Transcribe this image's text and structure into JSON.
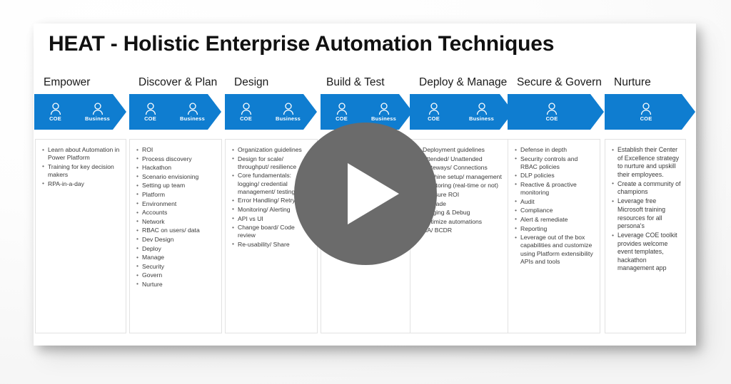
{
  "slide": {
    "title": "HEAT - Holistic Enterprise Automation Techniques",
    "accent_color": "#0F7DD0",
    "card_background": "#FFFFFF",
    "overlay_color": "#6B6B6B"
  },
  "player": {
    "play_button_label": "Play"
  },
  "phases": [
    {
      "name": "Empower",
      "personas": [
        {
          "label": "COE",
          "icon": "person-icon"
        },
        {
          "label": "Business",
          "icon": "person-icon"
        }
      ],
      "items": [
        "Learn about Automation in Power Platform",
        "Training for key decision makers",
        "RPA-in-a-day"
      ]
    },
    {
      "name": "Discover & Plan",
      "personas": [
        {
          "label": "COE",
          "icon": "person-icon"
        },
        {
          "label": "Business",
          "icon": "person-icon"
        }
      ],
      "items": [
        "ROI",
        "Process discovery",
        "Hackathon",
        "Scenario envisioning",
        "Setting up team",
        "Platform",
        "Environment",
        "Accounts",
        "Network",
        "RBAC on users/ data",
        "Dev Design",
        "Deploy",
        "Manage",
        "Security",
        "Govern",
        "Nurture"
      ]
    },
    {
      "name": "Design",
      "personas": [
        {
          "label": "COE",
          "icon": "person-icon"
        },
        {
          "label": "Business",
          "icon": "person-icon"
        }
      ],
      "items": [
        "Organization guidelines",
        "Design for scale/ throughput/ resilience",
        "Core fundamentals: logging/ credential management/ testing",
        "Error Handling/ Retry",
        "Monitoring/ Alerting",
        "API vs UI",
        "Change board/ Code review",
        "Re-usability/ Share"
      ]
    },
    {
      "name": "Build & Test",
      "personas": [
        {
          "label": "COE",
          "icon": "person-icon"
        },
        {
          "label": "Business",
          "icon": "person-icon"
        }
      ],
      "items": []
    },
    {
      "name": "Deploy & Manage",
      "personas": [
        {
          "label": "COE",
          "icon": "person-icon"
        },
        {
          "label": "Business",
          "icon": "person-icon"
        }
      ],
      "items": [
        "Deployment guidelines",
        "Attended/ Unattended",
        "Gateways/ Connections",
        "Machine setup/ management",
        "Monitoring (real-time or not)",
        "Measure ROI",
        "Upgrade",
        "Logging & Debug",
        "Optimize automations",
        "HA/ BCDR"
      ]
    },
    {
      "name": "Secure & Govern",
      "personas": [
        {
          "label": "COE",
          "icon": "person-icon"
        }
      ],
      "items": [
        "Defense in depth",
        "Security controls and RBAC policies",
        "DLP policies",
        "Reactive & proactive monitoring",
        "Audit",
        "Compliance",
        "Alert & remediate",
        "Reporting",
        "Leverage out of the box capabilities and customize using Platform extensibility APIs and tools"
      ]
    },
    {
      "name": "Nurture",
      "personas": [
        {
          "label": "COE",
          "icon": "person-icon"
        }
      ],
      "items": [
        "Establish their Center of Excellence strategy to nurture and upskill their employees.",
        "Create a community of champions",
        "Leverage free Microsoft training resources for all persona's",
        "Leverage COE toolkit provides welcome event templates, hackathon management app"
      ]
    }
  ]
}
